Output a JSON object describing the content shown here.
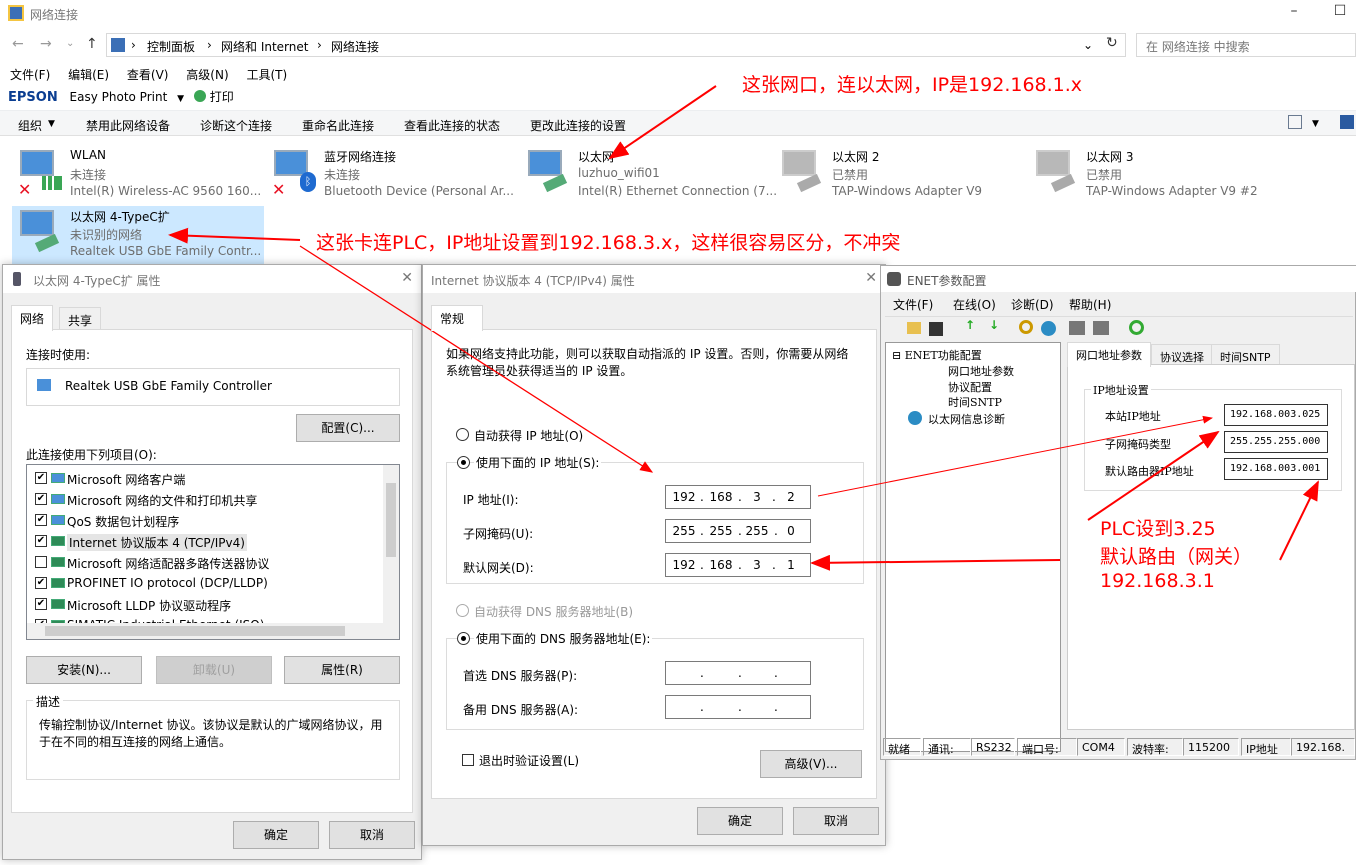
{
  "window": {
    "title": "网络连接"
  },
  "address": {
    "crumbs": [
      "控制面板",
      "网络和 Internet",
      "网络连接"
    ],
    "search_placeholder": "在 网络连接 中搜索"
  },
  "menu": [
    "文件(F)",
    "编辑(E)",
    "查看(V)",
    "高级(N)",
    "工具(T)"
  ],
  "epson": {
    "brand": "EPSON",
    "app": "Easy Photo Print",
    "print": "打印"
  },
  "commands": [
    "组织",
    "禁用此网络设备",
    "诊断这个连接",
    "重命名此连接",
    "查看此连接的状态",
    "更改此连接的设置"
  ],
  "adapters": [
    {
      "name": "WLAN",
      "status": "未连接",
      "device": "Intel(R) Wireless-AC 9560 160..."
    },
    {
      "name": "蓝牙网络连接",
      "status": "未连接",
      "device": "Bluetooth Device (Personal Ar..."
    },
    {
      "name": "以太网",
      "status": "luzhuo_wifi01",
      "device": "Intel(R) Ethernet Connection (7..."
    },
    {
      "name": "以太网 2",
      "status": "已禁用",
      "device": "TAP-Windows Adapter V9"
    },
    {
      "name": "以太网 3",
      "status": "已禁用",
      "device": "TAP-Windows Adapter V9 #2"
    },
    {
      "name": "以太网 4-TypeC扩",
      "status": "未识别的网络",
      "device": "Realtek USB GbE Family Contr..."
    }
  ],
  "annotations": {
    "a1": "这张网口，连以太网，IP是192.168.1.x",
    "a2": "这张卡连PLC，IP地址设置到192.168.3.x，这样很容易区分，不冲突",
    "a3_l1": "PLC设到3.25",
    "a3_l2": "默认路由（网关）",
    "a3_l3": "192.168.3.1"
  },
  "prop_dialog": {
    "title": "以太网 4-TypeC扩 属性",
    "tabs": [
      "网络",
      "共享"
    ],
    "connect_using_label": "连接时使用:",
    "adapter": "Realtek USB GbE Family Controller",
    "configure": "配置(C)...",
    "items_label": "此连接使用下列项目(O):",
    "items": [
      {
        "label": "Microsoft 网络客户端",
        "checked": "✔"
      },
      {
        "label": "Microsoft 网络的文件和打印机共享",
        "checked": "✔"
      },
      {
        "label": "QoS 数据包计划程序",
        "checked": "✔"
      },
      {
        "label": "Internet 协议版本 4 (TCP/IPv4)",
        "checked": "✔"
      },
      {
        "label": "Microsoft 网络适配器多路传送器协议",
        "checked": ""
      },
      {
        "label": "PROFINET IO protocol (DCP/LLDP)",
        "checked": "✔"
      },
      {
        "label": "Microsoft LLDP 协议驱动程序",
        "checked": "✔"
      },
      {
        "label": "SIMATIC Industrial Ethernet (ISO)",
        "checked": "✔"
      }
    ],
    "install": "安装(N)...",
    "uninstall": "卸载(U)",
    "properties": "属性(R)",
    "desc_label": "描述",
    "desc_text": "传输控制协议/Internet 协议。该协议是默认的广域网络协议，用于在不同的相互连接的网络上通信。",
    "ok": "确定",
    "cancel": "取消"
  },
  "ipv4_dialog": {
    "title": "Internet 协议版本 4 (TCP/IPv4) 属性",
    "tab": "常规",
    "intro": "如果网络支持此功能，则可以获取自动指派的 IP 设置。否则，你需要从网络系统管理员处获得适当的 IP 设置。",
    "auto_ip": "自动获得 IP 地址(O)",
    "manual_ip": "使用下面的 IP 地址(S):",
    "ip_label": "IP 地址(I):",
    "ip": [
      "192",
      "168",
      "3",
      "2"
    ],
    "mask_label": "子网掩码(U):",
    "mask": [
      "255",
      "255",
      "255",
      "0"
    ],
    "gw_label": "默认网关(D):",
    "gw": [
      "192",
      "168",
      "3",
      "1"
    ],
    "auto_dns": "自动获得 DNS 服务器地址(B)",
    "manual_dns": "使用下面的 DNS 服务器地址(E):",
    "dns1_label": "首选 DNS 服务器(P):",
    "dns2_label": "备用 DNS 服务器(A):",
    "validate": "退出时验证设置(L)",
    "advanced": "高级(V)...",
    "ok": "确定",
    "cancel": "取消"
  },
  "enet": {
    "title": "ENET参数配置",
    "menu": [
      "文件(F)",
      "在线(O)",
      "诊断(D)",
      "帮助(H)"
    ],
    "tree_root": "ENET功能配置",
    "tree_items": [
      "网口地址参数",
      "协议配置",
      "时间SNTP"
    ],
    "tree_diag": "以太网信息诊断",
    "tabs": [
      "网口地址参数",
      "协议选择",
      "时间SNTP"
    ],
    "group": "IP地址设置",
    "station_label": "本站IP地址",
    "station": "192.168.003.025",
    "mask_label": "子网掩码类型",
    "mask": "255.255.255.000",
    "gw_label": "默认路由器IP地址",
    "gw": "192.168.003.001",
    "status": [
      "就绪",
      "通讯:",
      "RS232",
      "端口号:",
      "COM4",
      "波特率:",
      "115200",
      "IP地址",
      "192.168."
    ]
  }
}
